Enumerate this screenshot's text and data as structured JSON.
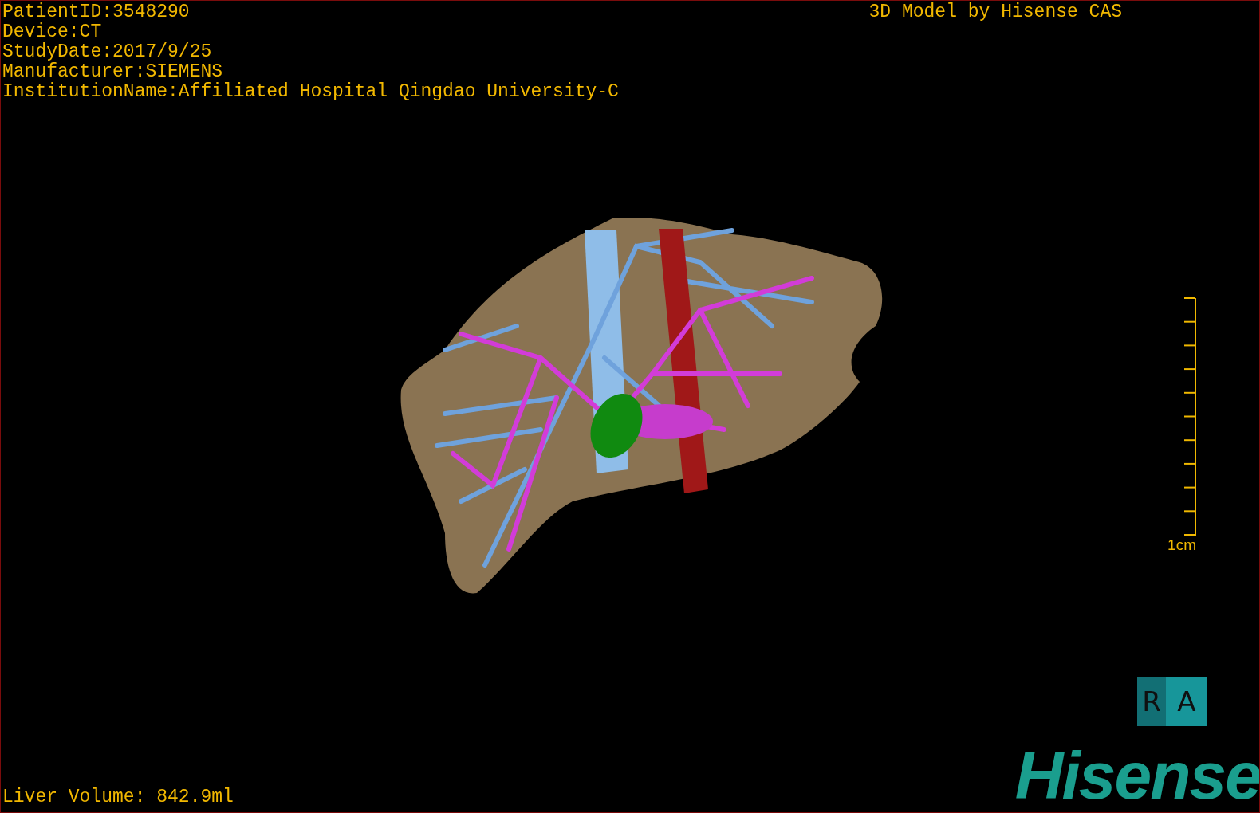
{
  "info_lines": [
    "PatientID:3548290",
    "Device:CT",
    "StudyDate:2017/9/25",
    "Manufacturer:SIEMENS",
    "InstitutionName:Affiliated Hospital Qingdao University-C"
  ],
  "title": "3D Model by Hisense CAS",
  "scale_bar": {
    "label": "1cm"
  },
  "orientation_cube": {
    "faces": [
      "R",
      "A"
    ]
  },
  "volume": "Liver Volume: 842.9ml",
  "logo": "Hisense"
}
